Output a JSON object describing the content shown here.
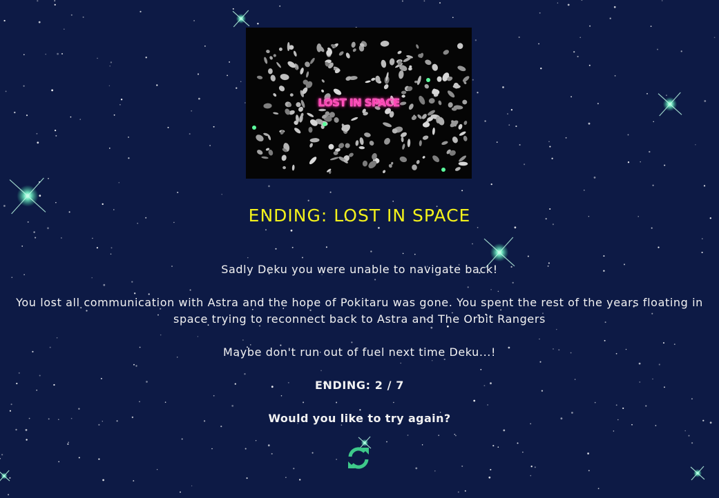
{
  "image": {
    "caption": "LOST IN SPACE"
  },
  "ending": {
    "title": "ENDING: LOST IN SPACE",
    "paragraphs": [
      "Sadly Deku you were unable to navigate back!",
      "You lost all communication with Astra and the hope of Pokitaru was gone. You spent the rest of the years floating in space trying to reconnect back to Astra and The Orbit Rangers",
      "Maybe don't run out of fuel next time Deku...!"
    ],
    "count_label": "ENDING: 2 / 7",
    "prompt": "Would you like to try again?"
  },
  "restart": {
    "icon": "refresh-icon",
    "label": "Try again"
  },
  "colors": {
    "background": "#0d1a45",
    "title": "#f4f21b",
    "body_text": "#f2f2f2",
    "caption_neon": "#ff3fb3",
    "restart_icon": "#3ec98a",
    "sparkle": "#7fffd0"
  }
}
